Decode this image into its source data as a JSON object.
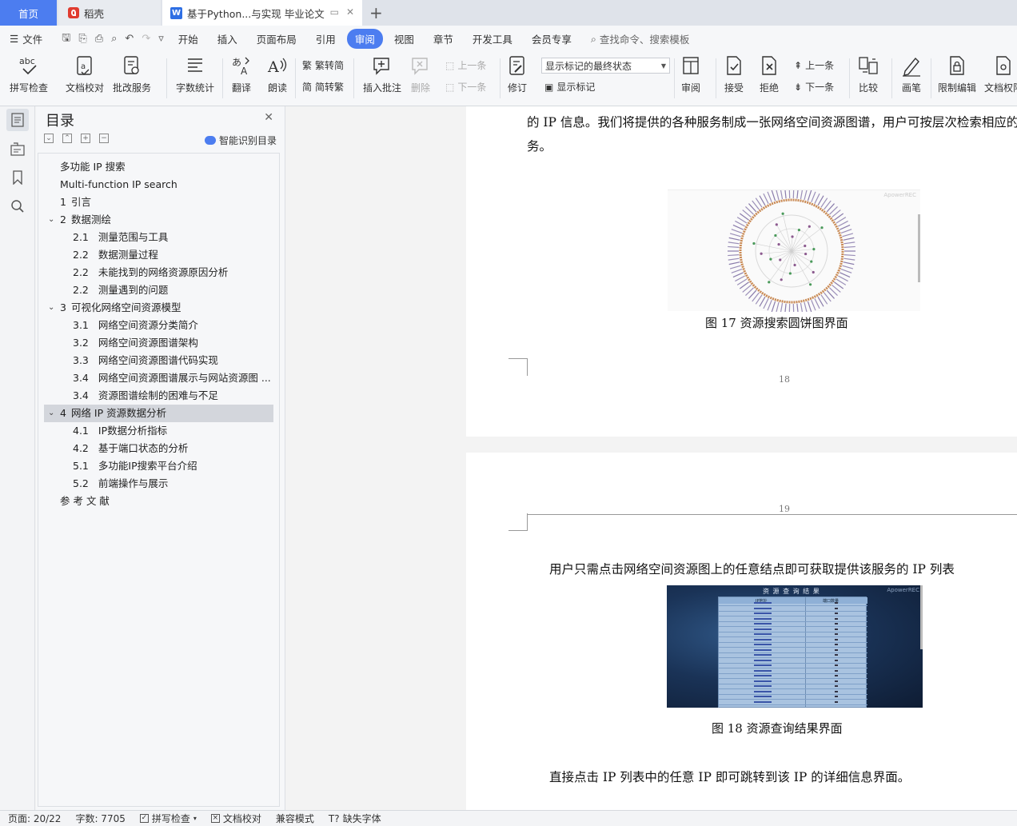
{
  "tabs": {
    "home": "首页",
    "daoke": "稻壳",
    "doc": "基于Python...与实现 毕业论文",
    "add": "+"
  },
  "menu": {
    "file": "文件",
    "items": [
      "开始",
      "插入",
      "页面布局",
      "引用",
      "审阅",
      "视图",
      "章节",
      "开发工具",
      "会员专享"
    ],
    "active": "审阅",
    "search": "查找命令、搜索模板"
  },
  "ribbon": {
    "spell": "拼写检查",
    "proof": "文档校对",
    "batch": "批改服务",
    "wordcount": "字数统计",
    "translate": "翻译",
    "read": "朗读",
    "t2s": "繁转简",
    "s2t": "简转繁",
    "insert_comment": "插入批注",
    "delete": "删除",
    "prev_comment": "上一条",
    "next_comment": "下一条",
    "revise": "修订",
    "markup_state": "显示标记的最终状态",
    "show_markup": "显示标记",
    "review": "审阅",
    "accept": "接受",
    "reject": "拒绝",
    "prev_change": "上一条",
    "next_change": "下一条",
    "compare": "比较",
    "pen": "画笔",
    "restrict": "限制编辑",
    "doc_perm": "文档权限"
  },
  "toc": {
    "title": "目录",
    "smart": "智能识别目录",
    "items": [
      {
        "num": "",
        "text": "多功能 IP 搜索",
        "level": 1,
        "chev": false
      },
      {
        "num": "",
        "text": "Multi-function IP search",
        "level": 1,
        "chev": false
      },
      {
        "num": "1",
        "text": "引言",
        "level": 1,
        "chev": false
      },
      {
        "num": "2",
        "text": "数据测绘",
        "level": 1,
        "chev": true
      },
      {
        "num": "2.1",
        "text": "测量范围与工具",
        "level": 2,
        "chev": false
      },
      {
        "num": "2.2",
        "text": "数据测量过程",
        "level": 2,
        "chev": false
      },
      {
        "num": "2.2",
        "text": "未能找到的网络资源原因分析",
        "level": 2,
        "chev": false
      },
      {
        "num": "2.2",
        "text": "测量遇到的问题",
        "level": 2,
        "chev": false
      },
      {
        "num": "3",
        "text": "可视化网络空间资源模型",
        "level": 1,
        "chev": true
      },
      {
        "num": "3.1",
        "text": "网络空间资源分类简介",
        "level": 2,
        "chev": false
      },
      {
        "num": "3.2",
        "text": "网络空间资源图谱架构",
        "level": 2,
        "chev": false
      },
      {
        "num": "3.3",
        "text": "网络空间资源图谱代码实现",
        "level": 2,
        "chev": false
      },
      {
        "num": "3.4",
        "text": "网络空间资源图谱展示与网站资源图 ...",
        "level": 2,
        "chev": false
      },
      {
        "num": "3.4",
        "text": "资源图谱绘制的困难与不足",
        "level": 2,
        "chev": false
      },
      {
        "num": "4",
        "text": "网络 IP 资源数据分析",
        "level": 1,
        "chev": true,
        "selected": true
      },
      {
        "num": "4.1",
        "text": "IP数据分析指标",
        "level": 2,
        "chev": false
      },
      {
        "num": "4.2",
        "text": "基于端口状态的分析",
        "level": 2,
        "chev": false
      },
      {
        "num": "5.1",
        "text": "多功能IP搜索平台介绍",
        "level": 2,
        "chev": false
      },
      {
        "num": "5.2",
        "text": "前端操作与展示",
        "level": 2,
        "chev": false
      },
      {
        "num": "",
        "text": "参 考 文 献",
        "level": 1,
        "chev": false
      }
    ]
  },
  "doc": {
    "p1_line1": "的 IP 信息。我们将提供的各种服务制成一张网络空间资源图谱，用户可按层次检索相应的",
    "p1_line2": "务。",
    "fig17_caption": "图 17    资源搜索圆饼图界面",
    "fig17_watermark": "ApowerREC",
    "page_num_18": "18",
    "page_num_19": "19",
    "p2_line1": "用户只需点击网络空间资源图上的任意结点即可获取提供该服务的 IP 列表",
    "fig18_title": "资 源 查 询 结 果",
    "fig18_col1": "IP地址",
    "fig18_col2": "端口数量",
    "fig18_watermark": "ApowerREC",
    "fig18_caption": "图 18    资源查询结果界面",
    "p2_line2": "直接点击 IP 列表中的任意 IP 即可跳转到该 IP 的详细信息界面。"
  },
  "status": {
    "page": "页面: 20/22",
    "words": "字数: 7705",
    "spell": "拼写检查",
    "proof": "文档校对",
    "compat": "兼容模式",
    "missing_font": "缺失字体"
  },
  "colors": {
    "accent": "#4c7df0",
    "selected_toc": "#d3d6dc"
  }
}
